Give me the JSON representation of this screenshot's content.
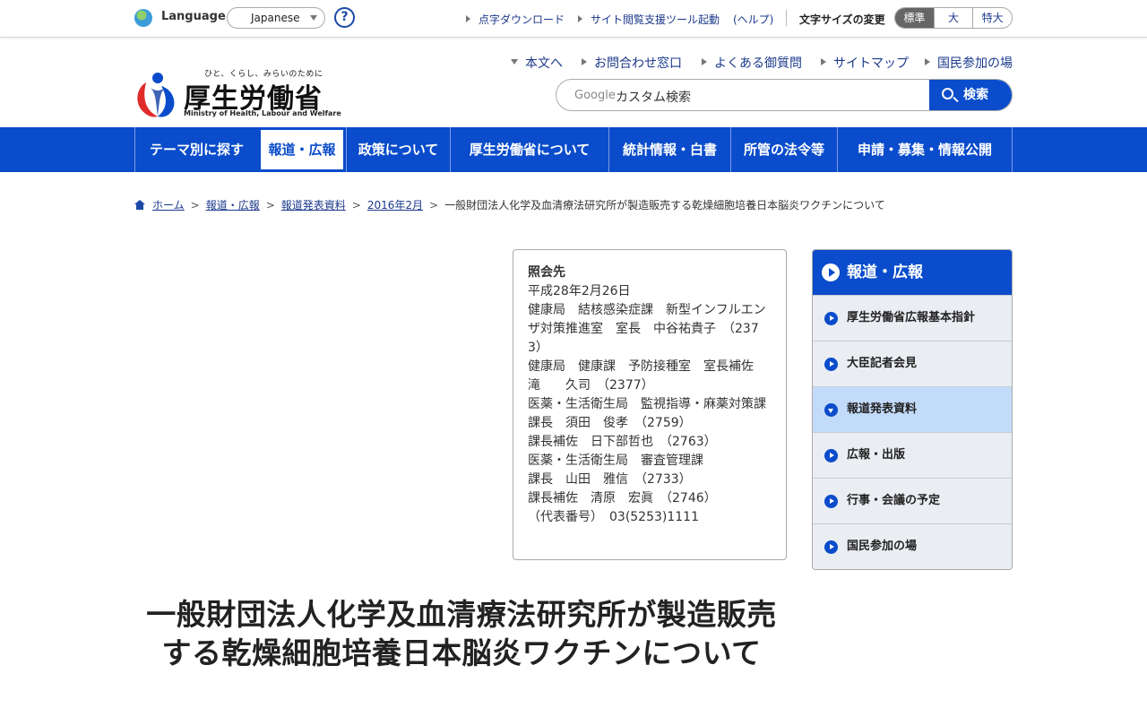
{
  "util": {
    "language_label": "Language",
    "language_value": "Japanese",
    "help": "?",
    "links": [
      "点字ダウンロード",
      "サイト閲覧支援ツール起動",
      "(ヘルプ)"
    ],
    "font_size_label": "文字サイズの変更",
    "font_sizes": [
      "標準",
      "大",
      "特大"
    ]
  },
  "header": {
    "logo_tagline": "ひと、くらし、みらいのために",
    "logo_name": "厚生労働省",
    "logo_en": "Ministry of Health, Labour and Welfare",
    "links": [
      "本文へ",
      "お問合わせ窓口",
      "よくある御質問",
      "サイトマップ",
      "国民参加の場"
    ],
    "search_brand": "Google",
    "search_placeholder": "カスタム検索",
    "search_button": "検索"
  },
  "nav": [
    "テーマ別に探す",
    "報道・広報",
    "政策について",
    "厚生労働省について",
    "統計情報・白書",
    "所管の法令等",
    "申請・募集・情報公開"
  ],
  "breadcrumb": [
    "ホーム",
    "報道・広報",
    "報道発表資料",
    "2016年2月",
    "一般財団法人化学及血清療法研究所が製造販売する乾燥細胞培養日本脳炎ワクチンについて"
  ],
  "contact": {
    "title": "照会先",
    "lines": [
      "平成28年2月26日",
      "健康局　結核感染症課　新型インフルエンザ対策推進室　室長　中谷祐貴子　（2373）",
      "健康局　健康課　予防接種室　室長補佐　滝　　久司　（2377）",
      "医薬・生活衛生局　監視指導・麻薬対策課　課長　須田　俊孝　（2759）",
      "課長補佐　日下部哲也　（2763）",
      "医薬・生活衛生局　審査管理課",
      "課長　山田　雅信　（2733）",
      "課長補佐　清原　宏眞　（2746）",
      "（代表番号）　03(5253)1111"
    ]
  },
  "sidebar": {
    "title": "報道・広報",
    "items": [
      "厚生労働省広報基本指針",
      "大臣記者会見",
      "報道発表資料",
      "広報・出版",
      "行事・会議の予定",
      "国民参加の場"
    ]
  },
  "page_title": "一般財団法人化学及血清療法研究所が製造販売する乾燥細胞培養日本脳炎ワクチンについて",
  "colors": {
    "brand_blue": "#0a4ccb",
    "sidebar_bg": "#eaedf2",
    "sidebar_active": "#c3dbfa"
  }
}
